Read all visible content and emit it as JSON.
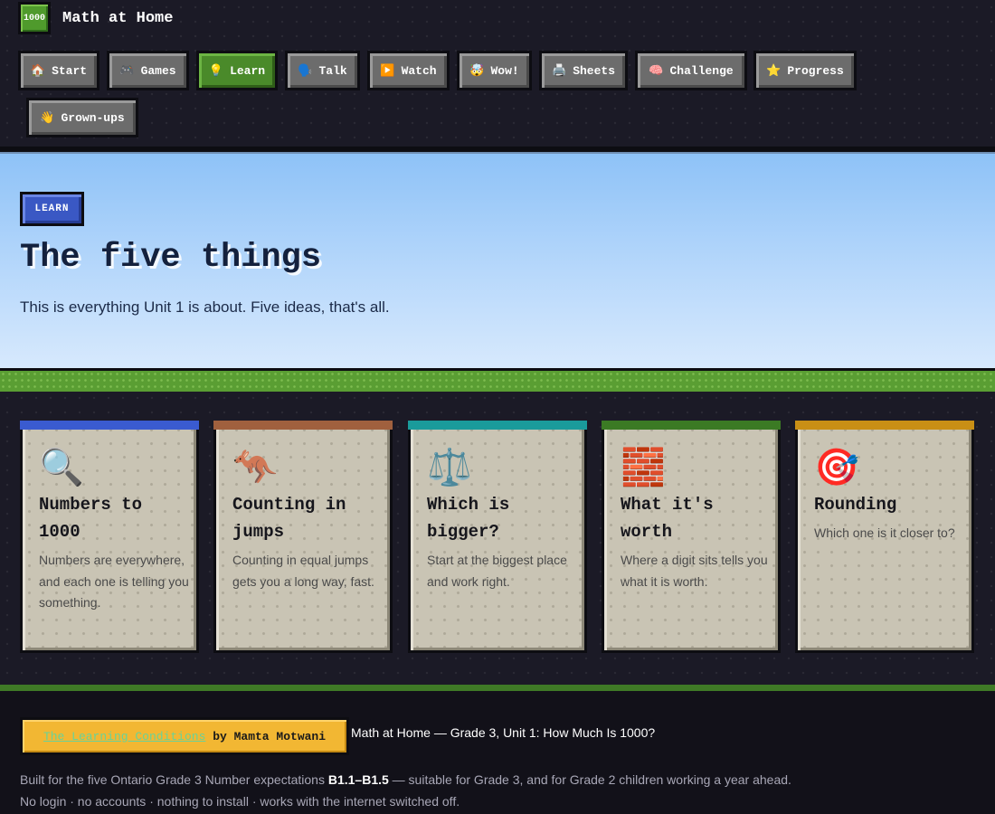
{
  "app": {
    "logo_text": "1000",
    "name": "Math at Home"
  },
  "nav": [
    {
      "icon": "🏠",
      "icon_name": "house-icon",
      "label": "Start"
    },
    {
      "icon": "🎮",
      "icon_name": "game-controller-icon",
      "label": "Games"
    },
    {
      "icon": "💡",
      "icon_name": "light-bulb-icon",
      "label": "Learn",
      "active": true
    },
    {
      "icon": "🗣️",
      "icon_name": "speaking-head-icon",
      "label": "Talk"
    },
    {
      "icon": "▶️",
      "icon_name": "play-icon",
      "label": "Watch"
    },
    {
      "icon": "🤯",
      "icon_name": "mind-blown-icon",
      "label": "Wow!"
    },
    {
      "icon": "🖨️",
      "icon_name": "printer-icon",
      "label": "Sheets"
    },
    {
      "icon": "🧠",
      "icon_name": "brain-icon",
      "label": "Challenge"
    },
    {
      "icon": "⭐",
      "icon_name": "star-icon",
      "label": "Progress"
    },
    {
      "icon": "👋",
      "icon_name": "waving-hand-icon",
      "label": "Grown-ups"
    }
  ],
  "hero": {
    "tag": "LEARN",
    "title": "The five things",
    "subtitle": "This is everything Unit 1 is about. Five ideas, that's all."
  },
  "cards": [
    {
      "icon": "🔍",
      "icon_name": "magnifying-glass-icon",
      "color": "#3a5bd0",
      "title": "Numbers to 1000",
      "desc": "Numbers are everywhere, and each one is telling you something."
    },
    {
      "icon": "🦘",
      "icon_name": "kangaroo-icon",
      "color": "#a0603e",
      "title": "Counting in jumps",
      "desc": "Counting in equal jumps gets you a long way, fast."
    },
    {
      "icon": "⚖️",
      "icon_name": "balance-scale-icon",
      "color": "#1a9b9b",
      "title": "Which is bigger?",
      "desc": "Start at the biggest place and work right."
    },
    {
      "icon": "🧱",
      "icon_name": "brick-icon",
      "color": "#3b7a24",
      "title": "What it's worth",
      "desc": "Where a digit sits tells you what it is worth."
    },
    {
      "icon": "🎯",
      "icon_name": "target-icon",
      "color": "#c98f15",
      "title": "Rounding",
      "desc": "Which one is it closer to?"
    }
  ],
  "footer": {
    "link": "The Learning Conditions",
    "by": "by Mamta Motwani",
    "app_line": "Math at Home — Grade 3, Unit 1: How Much Is 1000?",
    "line1_pre": "Built for the five Ontario Grade 3 Number expectations",
    "line1_bold": "B1.1–B1.5",
    "line1_post": "— suitable for Grade 3, and for Grade 2 children working a year ahead.",
    "line2": "No login · no accounts · nothing to install · works with the internet switched off."
  }
}
